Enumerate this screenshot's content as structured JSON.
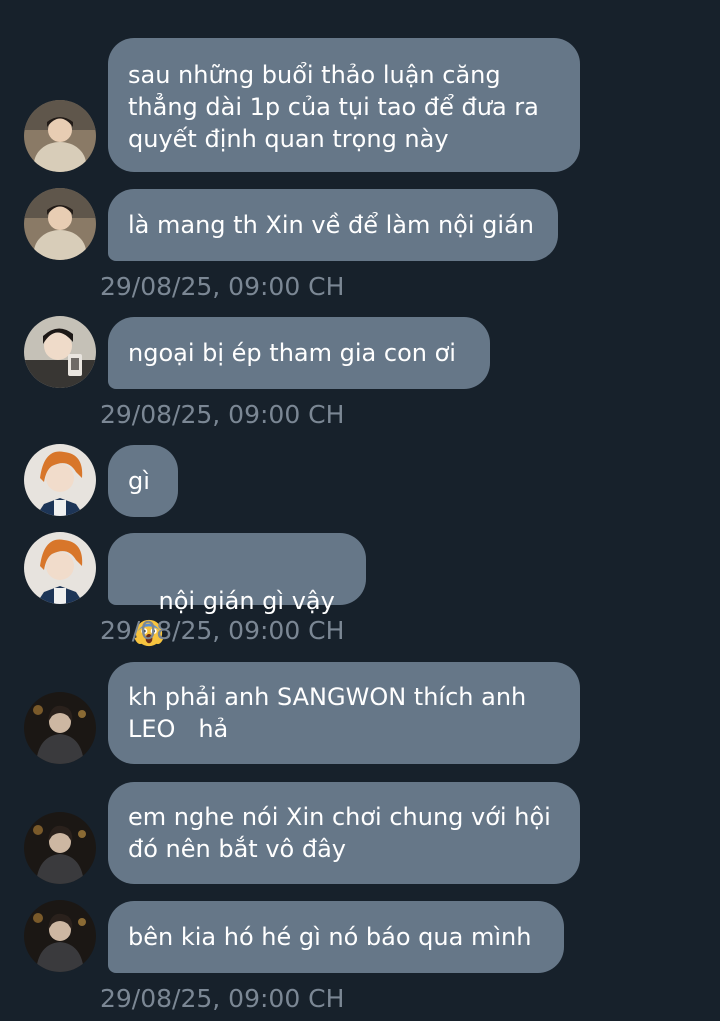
{
  "messages": [
    {
      "text": "sau những buổi thảo luận căng\nthẳng dài 1p của tụi tao để đưa ra\nquyết định quan trọng này",
      "avatar": "avatar-a"
    },
    {
      "text": "là mang th Xin về để làm nội gián",
      "avatar": "avatar-a"
    },
    {
      "text": "ngoại bị ép tham gia con ơi",
      "avatar": "avatar-b"
    },
    {
      "text": "gì",
      "avatar": "avatar-c"
    },
    {
      "text": "nội gián gì vậy",
      "emoji": "face-screaming-in-fear",
      "avatar": "avatar-c"
    },
    {
      "text": "kh phải anh SANGWON thích anh\nLEO   hả",
      "avatar": "avatar-d"
    },
    {
      "text": "em nghe nói Xin chơi chung với hội\nđó nên bắt vô đây",
      "avatar": "avatar-d"
    },
    {
      "text": "bên kia hó hé gì nó báo qua mình",
      "avatar": "avatar-d"
    }
  ],
  "timestamps": [
    "29/08/25, 09:00 CH",
    "29/08/25, 09:00 CH",
    "29/08/25, 09:00 CH",
    "29/08/25, 09:00 CH"
  ],
  "colors": {
    "background": "#17212b",
    "bubble": "#667788",
    "timestamp": "#7b8794"
  }
}
